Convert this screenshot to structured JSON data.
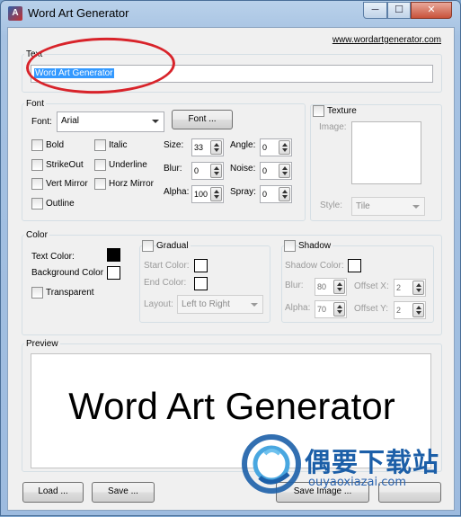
{
  "window": {
    "title": "Word Art Generator",
    "controls": {
      "minimize": "─",
      "maximize": "☐",
      "close": "✕"
    }
  },
  "header": {
    "link": "www.wordartgenerator.com"
  },
  "text_group": {
    "legend": "Text",
    "value": "Word Art Generator"
  },
  "font_group": {
    "legend": "Font",
    "font_label": "Font:",
    "font_value": "Arial",
    "font_button": "Font ...",
    "checkboxes": {
      "bold": "Bold",
      "italic": "Italic",
      "strikeout": "StrikeOut",
      "underline": "Underline",
      "vert_mirror": "Vert Mirror",
      "horz_mirror": "Horz Mirror",
      "outline": "Outline"
    },
    "size_label": "Size:",
    "size_value": "33",
    "blur_label": "Blur:",
    "blur_value": "0",
    "alpha_label": "Alpha:",
    "alpha_value": "100",
    "angle_label": "Angle:",
    "angle_value": "0",
    "noise_label": "Noise:",
    "noise_value": "0",
    "spray_label": "Spray:",
    "spray_value": "0"
  },
  "texture_group": {
    "legend": "Texture",
    "image_label": "Image:",
    "style_label": "Style:",
    "style_value": "Tile"
  },
  "color_group": {
    "legend": "Color",
    "text_color_label": "Text Color:",
    "text_color": "#000000",
    "background_color_label": "Background Color",
    "background_color": "#ffffff",
    "transparent_label": "Transparent"
  },
  "gradual_group": {
    "legend": "Gradual",
    "start_color_label": "Start Color:",
    "end_color_label": "End Color:",
    "layout_label": "Layout:",
    "layout_value": "Left to Right"
  },
  "shadow_group": {
    "legend": "Shadow",
    "shadow_color_label": "Shadow Color:",
    "blur_label": "Blur:",
    "blur_value": "80",
    "alpha_label": "Alpha:",
    "alpha_value": "70",
    "offset_x_label": "Offset X:",
    "offset_x_value": "2",
    "offset_y_label": "Offset Y:",
    "offset_y_value": "2"
  },
  "preview_group": {
    "legend": "Preview",
    "text": "Word Art Generator"
  },
  "buttons": {
    "load": "Load ...",
    "save": "Save ...",
    "save_image": "Save Image ..."
  },
  "watermark": {
    "cn": "偶要下载站",
    "url": "ouyaoxiazai.com"
  },
  "colors": {
    "selection": "#3399ff",
    "annotation_red": "#d8232a",
    "watermark_blue": "#1c5fa8"
  }
}
